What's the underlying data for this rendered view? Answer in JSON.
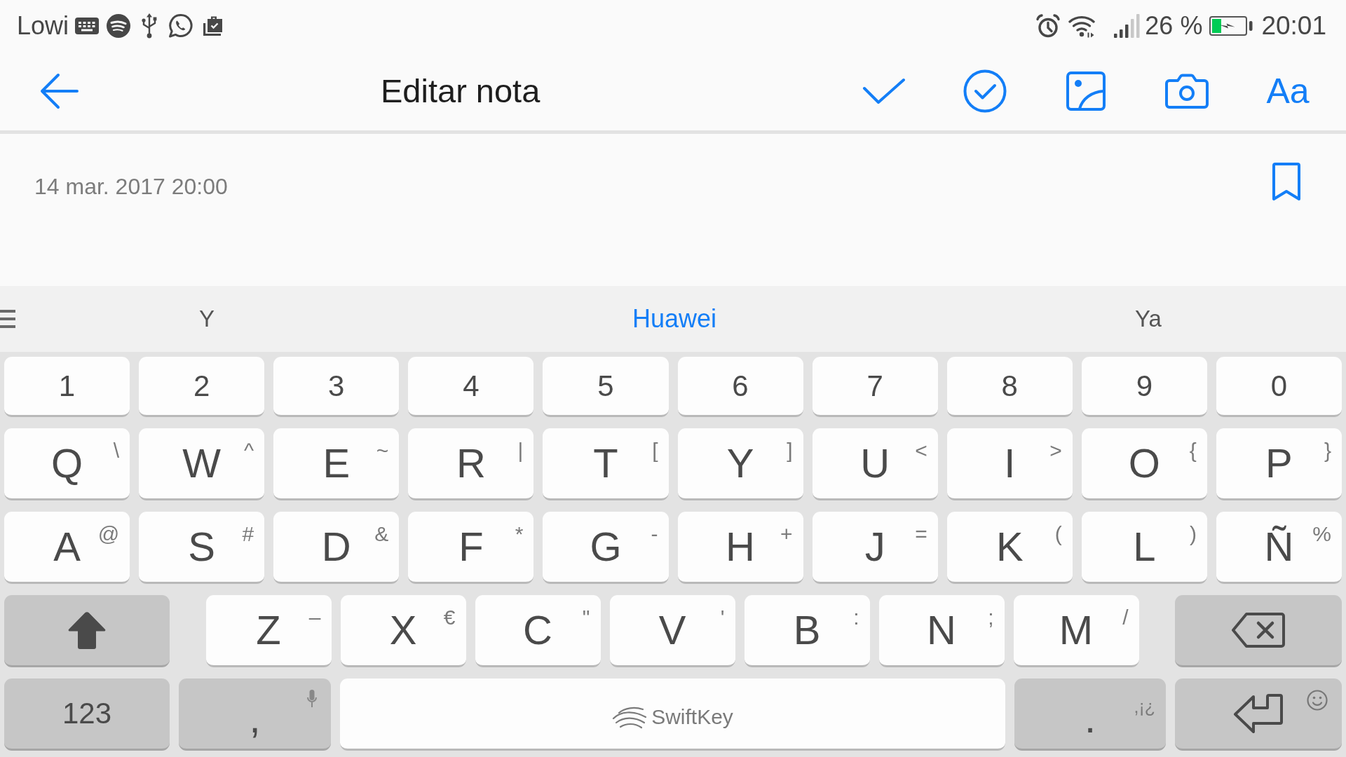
{
  "status_bar": {
    "carrier": "Lowi",
    "battery_text": "26 %",
    "time": "20:01"
  },
  "toolbar": {
    "title": "Editar nota",
    "font_button": "Aa"
  },
  "note": {
    "date": "14 mar. 2017 20:00"
  },
  "suggestions": [
    {
      "text": "Y",
      "selected": false
    },
    {
      "text": "Huawei",
      "selected": true
    },
    {
      "text": "Ya",
      "selected": false
    }
  ],
  "keyboard": {
    "rows": [
      {
        "kind": "numbers",
        "keys": [
          {
            "label": "1"
          },
          {
            "label": "2"
          },
          {
            "label": "3"
          },
          {
            "label": "4"
          },
          {
            "label": "5"
          },
          {
            "label": "6"
          },
          {
            "label": "7"
          },
          {
            "label": "8"
          },
          {
            "label": "9"
          },
          {
            "label": "0"
          }
        ]
      },
      {
        "kind": "letters",
        "keys": [
          {
            "label": "Q",
            "alt": "\\"
          },
          {
            "label": "W",
            "alt": "^"
          },
          {
            "label": "E",
            "alt": "~"
          },
          {
            "label": "R",
            "alt": "|"
          },
          {
            "label": "T",
            "alt": "["
          },
          {
            "label": "Y",
            "alt": "]"
          },
          {
            "label": "U",
            "alt": "<"
          },
          {
            "label": "I",
            "alt": ">"
          },
          {
            "label": "O",
            "alt": "{"
          },
          {
            "label": "P",
            "alt": "}"
          }
        ]
      },
      {
        "kind": "letters",
        "keys": [
          {
            "label": "A",
            "alt": "@"
          },
          {
            "label": "S",
            "alt": "#"
          },
          {
            "label": "D",
            "alt": "&"
          },
          {
            "label": "F",
            "alt": "*"
          },
          {
            "label": "G",
            "alt": "-"
          },
          {
            "label": "H",
            "alt": "+"
          },
          {
            "label": "J",
            "alt": "="
          },
          {
            "label": "K",
            "alt": "("
          },
          {
            "label": "L",
            "alt": ")"
          },
          {
            "label": "Ñ",
            "alt": "%"
          }
        ]
      },
      {
        "kind": "shift_row",
        "keys": [
          {
            "kind": "shift"
          },
          {
            "kind": "char",
            "label": "Z",
            "alt": "–"
          },
          {
            "kind": "char",
            "label": "X",
            "alt": "€"
          },
          {
            "kind": "char",
            "label": "C",
            "alt": "\""
          },
          {
            "kind": "char",
            "label": "V",
            "alt": "'"
          },
          {
            "kind": "char",
            "label": "B",
            "alt": ":"
          },
          {
            "kind": "char",
            "label": "N",
            "alt": ";"
          },
          {
            "kind": "char",
            "label": "M",
            "alt": "/"
          },
          {
            "kind": "backspace"
          }
        ]
      },
      {
        "kind": "bottom",
        "keys": [
          {
            "kind": "symbols",
            "label": "123"
          },
          {
            "kind": "comma",
            "label": ","
          },
          {
            "kind": "space",
            "label": "SwiftKey"
          },
          {
            "kind": "period",
            "label": ".",
            "alt": ",¡¿"
          },
          {
            "kind": "enter"
          }
        ]
      }
    ]
  }
}
